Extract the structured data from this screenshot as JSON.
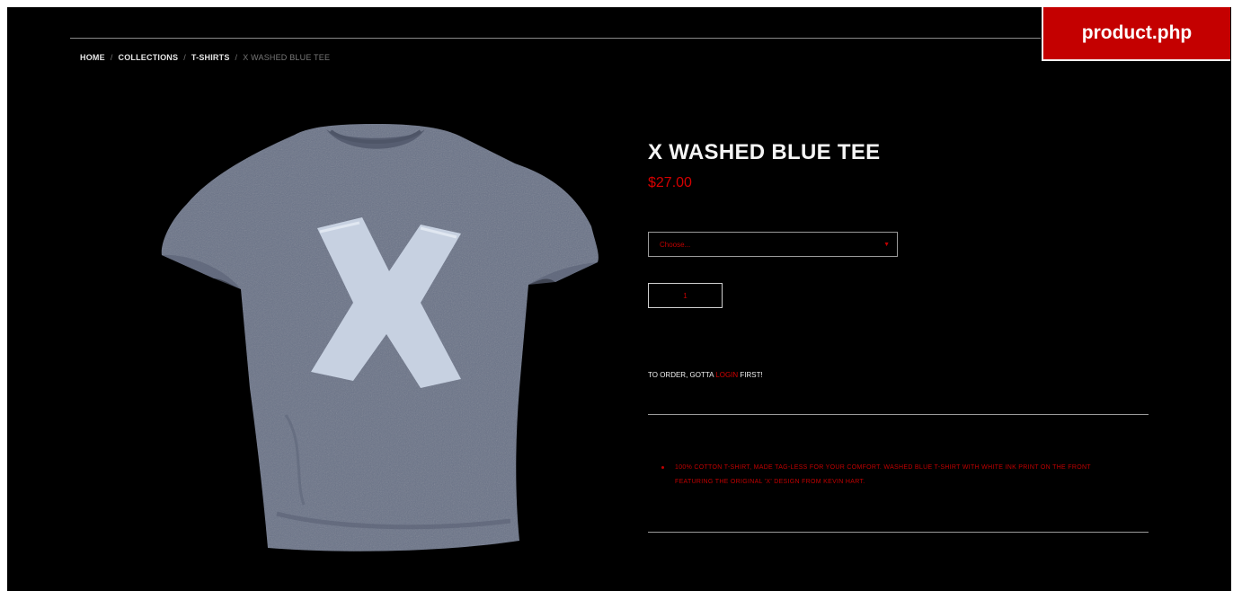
{
  "badge": {
    "file": "product.php"
  },
  "breadcrumb": {
    "items": [
      "HOME",
      "COLLECTIONS",
      "T-SHIRTS"
    ],
    "current": "X WASHED BLUE TEE",
    "separator": "/"
  },
  "product": {
    "title": "X WASHED BLUE TEE",
    "price": "$27.00",
    "option_placeholder": "Choose...",
    "quantity": "1",
    "image_alt": "x-washed-blue-tee-image"
  },
  "order": {
    "prefix": "TO ORDER, GOTTA ",
    "login_label": "LOGIN",
    "suffix": " FIRST!"
  },
  "description": {
    "bullets": [
      "100% COTTON T-SHIRT, MADE TAG-LESS FOR YOUR COMFORT. WASHED BLUE T-SHIRT WITH WHITE INK PRINT ON THE FRONT FEATURING THE ORIGINAL 'X' DESIGN FROM KEVIN HART."
    ]
  },
  "colors": {
    "background": "#000000",
    "accent_red": "#d40000",
    "badge_red": "#c40000",
    "shirt_blue_gray": "#6e7589",
    "print_white": "#c9d3e3"
  },
  "icons": {
    "select_arrow": "dropdown-arrow-icon"
  }
}
